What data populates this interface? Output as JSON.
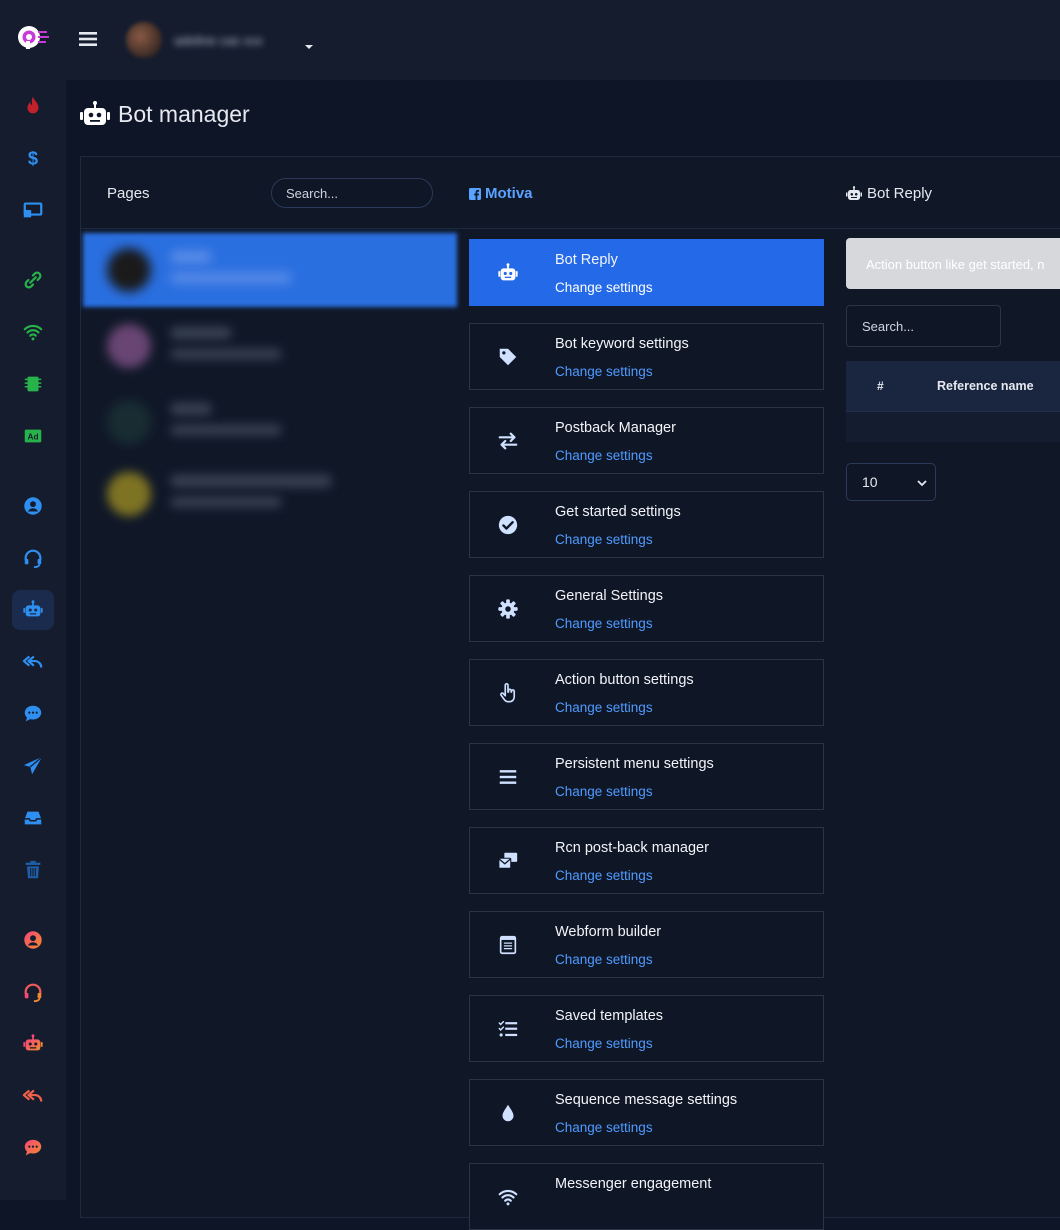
{
  "header": {
    "username": "adeline cas xxx"
  },
  "page": {
    "title": "Bot manager"
  },
  "pages_panel": {
    "title": "Pages",
    "search_placeholder": "Search...",
    "rows": [
      {
        "avatar_color": "#1a1a1a",
        "active": true
      },
      {
        "avatar_color": "#b06ab0",
        "active": false
      },
      {
        "avatar_color": "#1e3a3a",
        "active": false
      },
      {
        "avatar_color": "#c8b020",
        "active": false
      }
    ]
  },
  "facebook_page": {
    "name": "Motiva"
  },
  "menu": {
    "items": [
      {
        "title": "Bot Reply",
        "link": "Change settings",
        "icon": "robot-icon",
        "active": true
      },
      {
        "title": "Bot keyword settings",
        "link": "Change settings",
        "icon": "tag-icon"
      },
      {
        "title": "Postback Manager",
        "link": "Change settings",
        "icon": "exchange-icon"
      },
      {
        "title": "Get started settings",
        "link": "Change settings",
        "icon": "check-circle-icon"
      },
      {
        "title": "General Settings",
        "link": "Change settings",
        "icon": "gear-icon"
      },
      {
        "title": "Action button settings",
        "link": "Change settings",
        "icon": "hand-pointer-icon"
      },
      {
        "title": "Persistent menu settings",
        "link": "Change settings",
        "icon": "bars-icon"
      },
      {
        "title": "Rcn post-back manager",
        "link": "Change settings",
        "icon": "mail-bulk-icon"
      },
      {
        "title": "Webform builder",
        "link": "Change settings",
        "icon": "form-icon"
      },
      {
        "title": "Saved templates",
        "link": "Change settings",
        "icon": "tasks-icon"
      },
      {
        "title": "Sequence message settings",
        "link": "Change settings",
        "icon": "drop-icon"
      },
      {
        "title": "Messenger engagement",
        "link": "",
        "icon": "wifi-icon"
      }
    ]
  },
  "bot_reply_panel": {
    "title": "Bot Reply",
    "alert_text": "Action button like get started, n",
    "search_placeholder": "Search...",
    "table": {
      "columns": [
        "#",
        "Reference name"
      ]
    },
    "page_length": "10"
  },
  "colors": {
    "accent": "#2369e8",
    "link": "#4f9bff",
    "background": "#0e1526"
  }
}
